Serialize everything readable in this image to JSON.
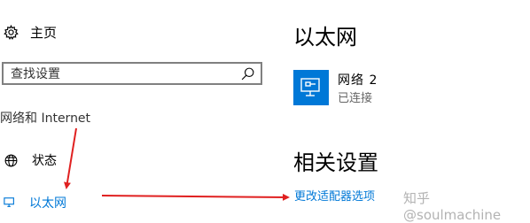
{
  "nav": {
    "home_label": "主页",
    "search_placeholder": "查找设置",
    "section_heading": "网络和 Internet",
    "items": [
      {
        "label": "状态",
        "icon": "globe-icon",
        "selected": false
      },
      {
        "label": "以太网",
        "icon": "ethernet-icon",
        "selected": true
      }
    ]
  },
  "main": {
    "title": "以太网",
    "network": {
      "name": "网络 2",
      "status": "已连接",
      "icon": "monitor-icon"
    },
    "related_heading": "相关设置",
    "related_link": "更改适配器选项"
  },
  "watermark": "知乎 @soulmachine",
  "colors": {
    "accent": "#0078d7",
    "annotation_arrow": "#e02020"
  }
}
